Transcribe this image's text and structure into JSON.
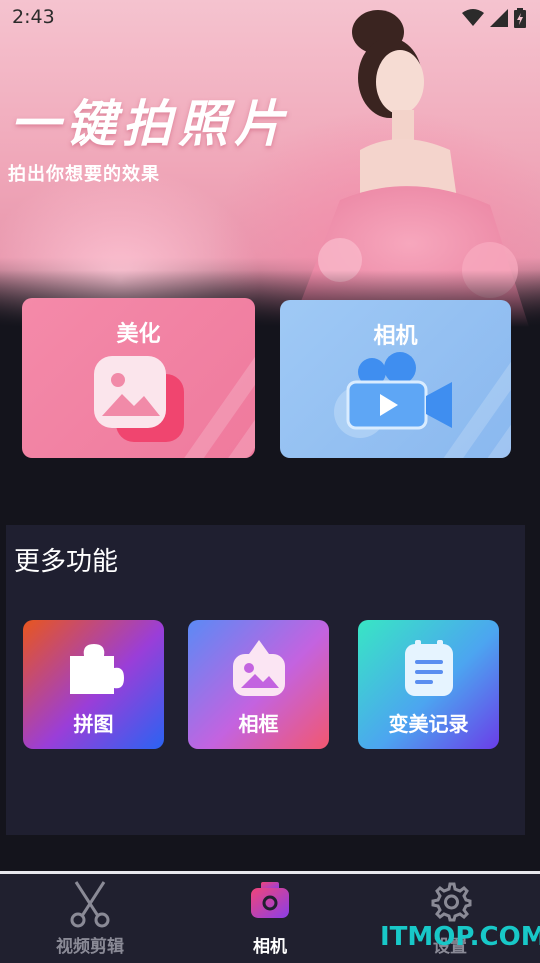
{
  "status_bar": {
    "time": "2:43"
  },
  "hero": {
    "title": "一键拍照片",
    "subtitle": "拍出你想要的效果"
  },
  "cards": [
    {
      "label": "美化",
      "icon": "image-icon"
    },
    {
      "label": "相机",
      "icon": "video-camera-icon"
    }
  ],
  "more": {
    "title": "更多功能",
    "items": [
      {
        "label": "拼图",
        "icon": "puzzle-icon"
      },
      {
        "label": "相框",
        "icon": "photo-frame-icon"
      },
      {
        "label": "变美记录",
        "icon": "notepad-icon"
      }
    ]
  },
  "nav": {
    "items": [
      {
        "label": "视频剪辑",
        "icon": "scissors-icon"
      },
      {
        "label": "相机",
        "icon": "camera-icon",
        "active": true
      },
      {
        "label": "设置",
        "icon": "gear-icon"
      }
    ]
  },
  "watermark": "ITMOP.COM",
  "colors": {
    "background": "#14141c",
    "beauty_card": "#f48aa9",
    "camera_card": "#9fc9f5",
    "nav_active": "#ffffff",
    "nav_inactive": "#8a8a96"
  }
}
